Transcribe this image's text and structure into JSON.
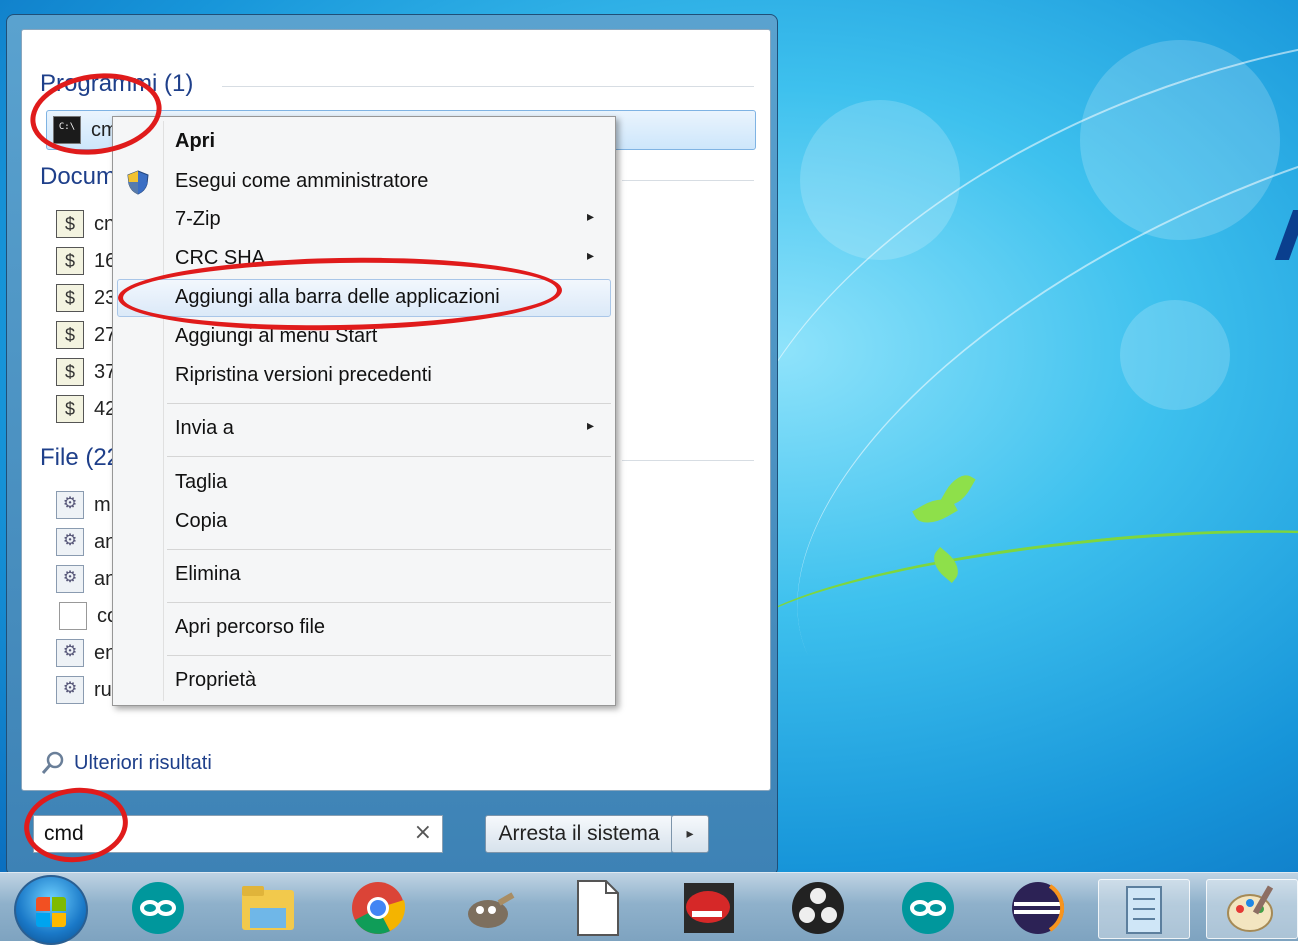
{
  "start_menu": {
    "groups": {
      "programs": {
        "title": "Programmi (1)"
      },
      "documents": {
        "title": "Docum"
      },
      "files": {
        "title": "File (22"
      }
    },
    "program_item": {
      "label": "cmd",
      "icon": "cmd-icon"
    },
    "document_items": [
      {
        "label": "cn"
      },
      {
        "label": "16"
      },
      {
        "label": "23"
      },
      {
        "label": "27"
      },
      {
        "label": "37"
      },
      {
        "label": "42"
      }
    ],
    "file_items": [
      {
        "label": "m",
        "icon": "config-file-icon"
      },
      {
        "label": "an",
        "icon": "config-file-icon"
      },
      {
        "label": "an",
        "icon": "config-file-icon"
      },
      {
        "label": "co",
        "icon": "blank-file-icon"
      },
      {
        "label": "en",
        "icon": "config-file-icon"
      },
      {
        "label": "ru",
        "icon": "config-file-icon"
      }
    ],
    "more_results": "Ulteriori risultati",
    "search": {
      "value": "cmd",
      "clear": "×"
    },
    "shutdown": {
      "label": "Arresta il sistema",
      "arrow": "▸"
    }
  },
  "context_menu": {
    "items": {
      "open": "Apri",
      "run_as_admin": "Esegui come amministratore",
      "seven_zip": "7-Zip",
      "crc_sha": "CRC SHA",
      "pin_taskbar": "Aggiungi alla barra delle applicazioni",
      "pin_start": "Aggiungi al menu Start",
      "restore": "Ripristina versioni precedenti",
      "send_to": "Invia a",
      "cut": "Taglia",
      "copy": "Copia",
      "delete": "Elimina",
      "open_location": "Apri percorso file",
      "properties": "Proprietà"
    },
    "submenu_arrow": "▸"
  },
  "taskbar": {
    "icons": [
      "windows-start-icon",
      "arduino-icon",
      "file-explorer-icon",
      "chrome-icon",
      "gimp-icon",
      "blank-document-icon",
      "game-icon",
      "obs-icon",
      "arduino-icon",
      "eclipse-icon",
      "notepad-icon",
      "paint-icon"
    ]
  },
  "colors": {
    "annotation": "#e01b1b",
    "group_title": "#1e3f8a",
    "desktop": "#1795d9"
  }
}
